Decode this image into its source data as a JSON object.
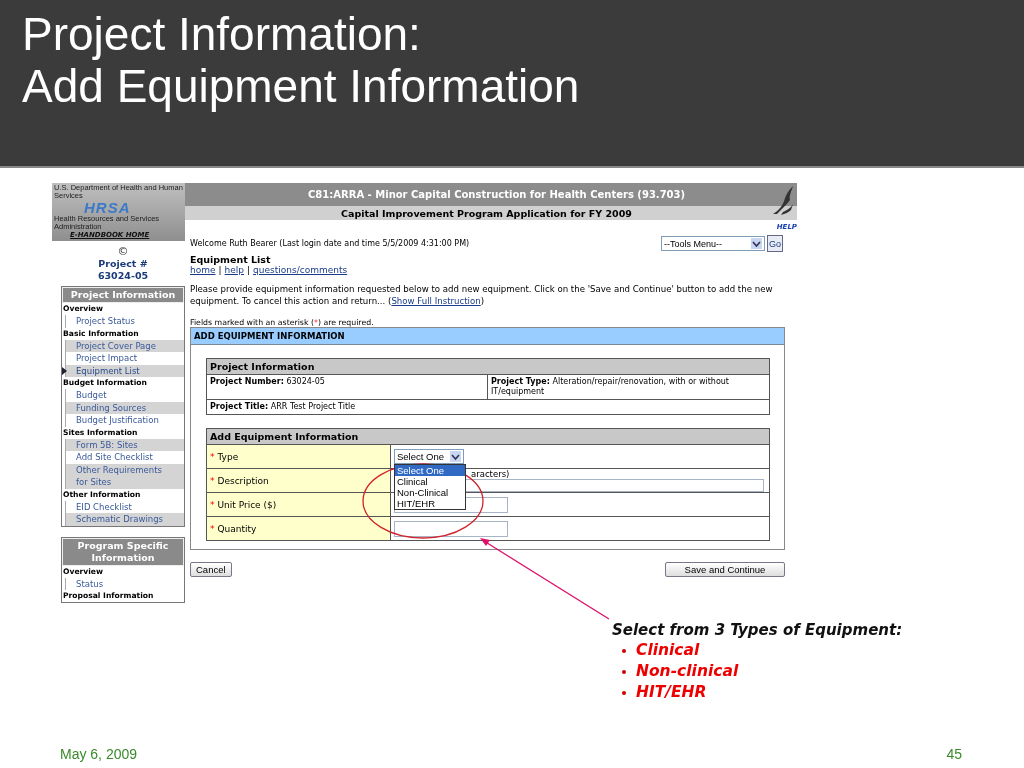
{
  "slide": {
    "title_lines": [
      "Project Information:",
      "Add Equipment Information"
    ],
    "date": "May 6, 2009",
    "page_number": "45",
    "callout": {
      "heading": "Select from 3 Types of Equipment:",
      "items": [
        "Clinical",
        "Non-clinical",
        "HIT/EHR"
      ]
    }
  },
  "app": {
    "header": {
      "department": "U.S. Department of Health and Human Services",
      "logo": "HRSA",
      "agency": "Health Resources and Services Administration",
      "handbook_link": "E-HANDBOOK HOME",
      "title": "C81:ARRA - Minor Capital Construction for Health Centers (93.703)",
      "subtitle": "Capital Improvement Program Application for FY 2009",
      "help": "HELP"
    },
    "sidebar": {
      "symbol": "©",
      "project_label": "Project #",
      "project_number": "63024-05",
      "panels": [
        {
          "title": "Project Information",
          "groups": [
            {
              "heading": "Overview",
              "items": [
                {
                  "label": "Project Status",
                  "current": false
                }
              ]
            },
            {
              "heading": "Basic Information",
              "items": [
                {
                  "label": "Project Cover Page",
                  "current": false
                },
                {
                  "label": "Project Impact",
                  "current": false
                },
                {
                  "label": "Equipment List",
                  "current": true
                }
              ]
            },
            {
              "heading": "Budget Information",
              "items": [
                {
                  "label": "Budget",
                  "current": false
                },
                {
                  "label": "Funding Sources",
                  "current": false
                },
                {
                  "label": "Budget Justification",
                  "current": false
                }
              ]
            },
            {
              "heading": "Sites Information",
              "items": [
                {
                  "label": "Form 5B: Sites",
                  "current": false
                },
                {
                  "label": "Add Site Checklist",
                  "current": false
                },
                {
                  "label": "Other Requirements for Sites",
                  "current": false
                }
              ]
            },
            {
              "heading": "Other Information",
              "items": [
                {
                  "label": "EID Checklist",
                  "current": false
                },
                {
                  "label": "Schematic Drawings",
                  "current": false
                }
              ]
            }
          ]
        },
        {
          "title": "Program Specific Information",
          "groups": [
            {
              "heading": "Overview",
              "items": [
                {
                  "label": "Status",
                  "current": false
                }
              ]
            },
            {
              "heading": "Proposal Information"
            }
          ]
        }
      ]
    },
    "main": {
      "welcome": "Welcome Ruth Bearer (Last login date and time 5/5/2009 4:31:00 PM)",
      "tools_menu": "--Tools Menu--",
      "go_button": "Go",
      "page_title": "Equipment List",
      "links": [
        "home",
        "help",
        "questions/comments"
      ],
      "link_separator": "|",
      "instruction": "Please provide equipment information requested below to add new equipment. Click on the 'Save and Continue' button to add the new equipment. To cancel this action and return... (",
      "instruction_link": "Show Full Instruction",
      "instruction_end": ")",
      "required_note": {
        "before": "Fields marked with an asterisk (",
        "mark": "*",
        "after": ") are required."
      },
      "form": {
        "title": "ADD EQUIPMENT INFORMATION",
        "project_info": {
          "heading": "Project Information",
          "number_label": "Project Number:",
          "number": "63024-05",
          "type_label": "Project Type:",
          "type": "Alteration/repair/renovation, with or without IT/equipment",
          "title_label": "Project Title:",
          "title": "ARR Test Project Title"
        },
        "equipment": {
          "heading": "Add Equipment Information",
          "rows": [
            {
              "kind": "select",
              "mark": "*",
              "label": "Type",
              "value": "Select One",
              "expanded": true,
              "options": [
                {
                  "label": "Select One",
                  "selected": true
                },
                {
                  "label": "Clinical",
                  "selected": false
                },
                {
                  "label": "Non-Clinical",
                  "selected": false
                },
                {
                  "label": "HIT/EHR",
                  "selected": false
                }
              ]
            },
            {
              "kind": "textarea",
              "mark": "*",
              "label": "Description",
              "hint": "aracters)"
            },
            {
              "kind": "short",
              "mark": "*",
              "label": "Unit Price ($)"
            },
            {
              "kind": "short",
              "mark": "*",
              "label": "Quantity"
            }
          ]
        }
      },
      "cancel_button": "Cancel",
      "save_button": "Save and Continue"
    }
  }
}
